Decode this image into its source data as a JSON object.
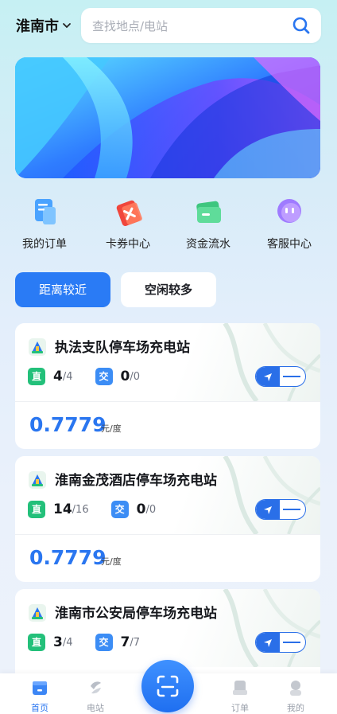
{
  "header": {
    "city": "淮南市",
    "search_placeholder": "查找地点/电站"
  },
  "quick_actions": [
    {
      "label": "我的订单",
      "icon": "orders-icon"
    },
    {
      "label": "卡券中心",
      "icon": "coupon-icon"
    },
    {
      "label": "资金流水",
      "icon": "wallet-icon"
    },
    {
      "label": "客服中心",
      "icon": "service-chat-icon"
    }
  ],
  "sort_tabs": {
    "active": "距离较近",
    "inactive": "空闲较多"
  },
  "stations": [
    {
      "name": "执法支队停车场充电站",
      "dc_badge": "直",
      "dc_free": "4",
      "dc_total": "/4",
      "ac_badge": "交",
      "ac_free": "0",
      "ac_total": "/0",
      "price": "0.7779",
      "unit": "元/度"
    },
    {
      "name": "淮南金茂酒店停车场充电站",
      "dc_badge": "直",
      "dc_free": "14",
      "dc_total": "/16",
      "ac_badge": "交",
      "ac_free": "0",
      "ac_total": "/0",
      "price": "0.7779",
      "unit": "元/度"
    },
    {
      "name": "淮南市公安局停车场充电站",
      "dc_badge": "直",
      "dc_free": "3",
      "dc_total": "/4",
      "ac_badge": "交",
      "ac_free": "7",
      "ac_total": "/7",
      "price": "",
      "unit": ""
    }
  ],
  "bottom_nav": [
    {
      "label": "首页",
      "icon": "home-icon",
      "active": true
    },
    {
      "label": "电站",
      "icon": "station-icon",
      "active": false
    },
    {
      "label": "订单",
      "icon": "order-icon",
      "active": false
    },
    {
      "label": "我的",
      "icon": "profile-icon",
      "active": false
    }
  ],
  "colors": {
    "primary": "#2a76f0",
    "dc_green": "#23c07a",
    "ac_blue": "#3c8df5"
  }
}
